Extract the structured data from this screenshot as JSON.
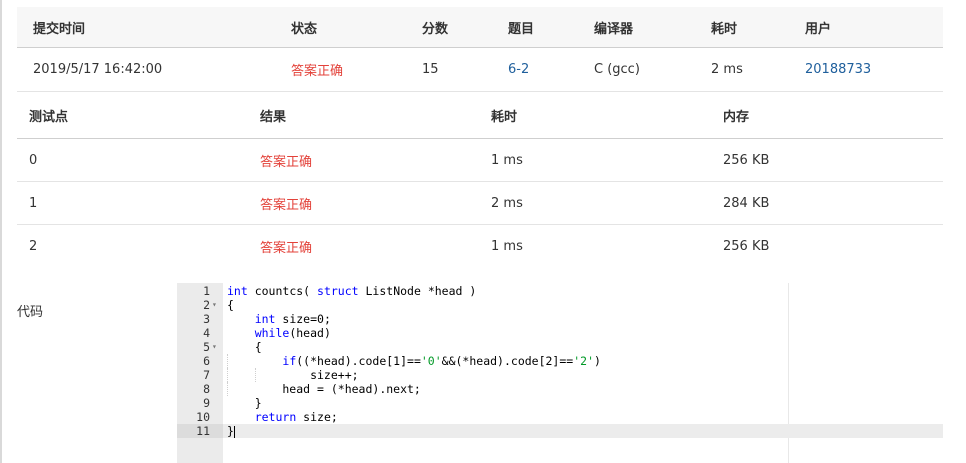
{
  "submission": {
    "headers": [
      "提交时间",
      "状态",
      "分数",
      "题目",
      "编译器",
      "耗时",
      "用户"
    ],
    "row": {
      "time": "2019/5/17 16:42:00",
      "status": "答案正确",
      "score": "15",
      "problem": "6-2",
      "compiler": "C (gcc)",
      "duration": "2 ms",
      "user": "20188733"
    }
  },
  "testcases": {
    "headers": [
      "测试点",
      "结果",
      "耗时",
      "内存"
    ],
    "rows": [
      {
        "id": "0",
        "result": "答案正确",
        "time": "1 ms",
        "memory": "256 KB"
      },
      {
        "id": "1",
        "result": "答案正确",
        "time": "2 ms",
        "memory": "284 KB"
      },
      {
        "id": "2",
        "result": "答案正确",
        "time": "1 ms",
        "memory": "256 KB"
      }
    ]
  },
  "code_section": {
    "label": "代码",
    "line_numbers": [
      "1",
      "2",
      "3",
      "4",
      "5",
      "6",
      "7",
      "8",
      "9",
      "10",
      "11"
    ],
    "fold_marker": "▾",
    "tokens": {
      "l1_kw1": "int",
      "l1_t1": " countcs( ",
      "l1_kw2": "struct",
      "l1_t2": " ListNode *head )",
      "l2": "{",
      "l3_indent": "    ",
      "l3_kw": "int",
      "l3_t": " size=0;",
      "l4_indent": "    ",
      "l4_kw": "while",
      "l4_t": "(head)",
      "l5": "    {",
      "l6_indent": "        ",
      "l6_kw": "if",
      "l6_t1": "((*head).code[1]==",
      "l6_s1": "'0'",
      "l6_t2": "&&(*head).code[2]==",
      "l6_s2": "'2'",
      "l6_t3": ")",
      "l7": "            size++;",
      "l8": "        head = (*head).next;",
      "l9": "    }",
      "l10_indent": "    ",
      "l10_kw": "return",
      "l10_t": " size;",
      "l11": "}"
    }
  },
  "colors": {
    "accepted": "#e3423a",
    "link": "#1f5f9c",
    "keyword": "#0000ff",
    "string": "#009926"
  }
}
